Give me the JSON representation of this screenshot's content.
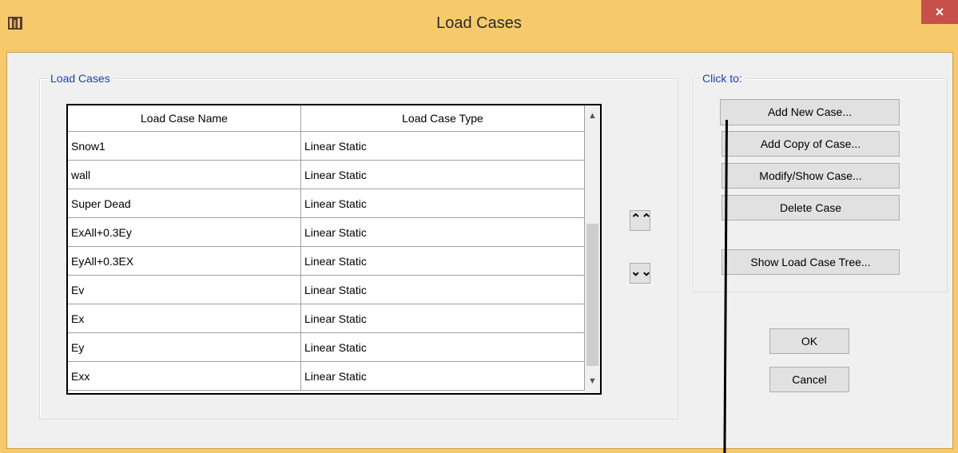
{
  "window": {
    "title": "Load Cases",
    "close_symbol": "×"
  },
  "load_cases_group": {
    "legend": "Load Cases",
    "columns": [
      "Load Case Name",
      "Load Case Type"
    ],
    "rows": [
      {
        "name": "Snow1",
        "type": "Linear Static"
      },
      {
        "name": "wall",
        "type": "Linear Static"
      },
      {
        "name": "Super Dead",
        "type": "Linear Static"
      },
      {
        "name": "ExAll+0.3Ey",
        "type": "Linear Static"
      },
      {
        "name": "EyAll+0.3EX",
        "type": "Linear Static"
      },
      {
        "name": "Ev",
        "type": "Linear Static"
      },
      {
        "name": "Ex",
        "type": "Linear Static"
      },
      {
        "name": "Ey",
        "type": "Linear Static"
      },
      {
        "name": "Exx",
        "type": "Linear Static"
      }
    ]
  },
  "click_to_group": {
    "legend": "Click to:",
    "add_new": "Add New Case...",
    "add_copy": "Add Copy of Case...",
    "modify_show": "Modify/Show Case...",
    "delete": "Delete Case",
    "show_tree": "Show Load Case Tree..."
  },
  "move_up_symbol": "⌃⌃",
  "move_down_symbol": "⌄⌄",
  "ok_label": "OK",
  "cancel_label": "Cancel",
  "colors": {
    "titlebar": "#f6c96b",
    "legend": "#1e3fb5",
    "close": "#c7504a"
  }
}
